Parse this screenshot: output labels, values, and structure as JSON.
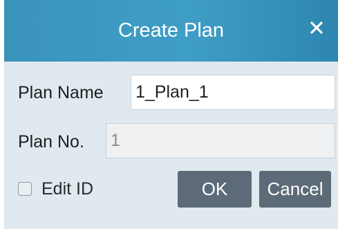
{
  "dialog": {
    "title": "Create Plan",
    "close_icon": "close-icon"
  },
  "form": {
    "plan_name_label": "Plan Name",
    "plan_name_value": "1_Plan_1",
    "plan_no_label": "Plan No.",
    "plan_no_value": "1",
    "plan_no_disabled": true,
    "edit_id_label": "Edit ID",
    "edit_id_checked": false
  },
  "buttons": {
    "ok_label": "OK",
    "cancel_label": "Cancel"
  },
  "colors": {
    "title_bar": "#3f9ec6",
    "dialog_bg": "#dfe9ef",
    "button_bg": "#5c6b77"
  }
}
